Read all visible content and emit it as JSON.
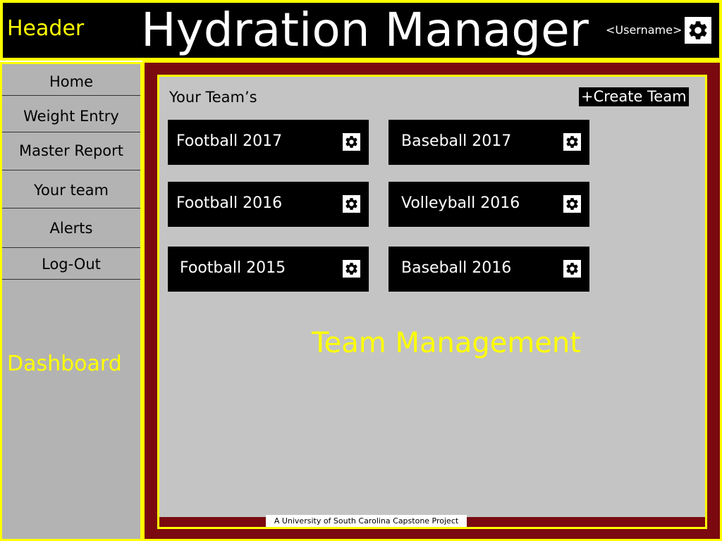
{
  "header": {
    "tag": "Header",
    "title": "Hydration Manager",
    "username": "<Username>",
    "settings_icon": "gear-icon"
  },
  "sidebar": {
    "tag": "Dashboard",
    "items": [
      {
        "label": "Home"
      },
      {
        "label": "Weight Entry"
      },
      {
        "label": "Master Report"
      },
      {
        "label": "Your team"
      },
      {
        "label": "Alerts"
      },
      {
        "label": "Log-Out"
      }
    ]
  },
  "main": {
    "section_title": "Your Team’s",
    "create_team_label": "+Create Team",
    "teams": [
      {
        "name": "Football 2017",
        "icon": "gear-icon"
      },
      {
        "name": "Baseball 2017",
        "icon": "gear-icon"
      },
      {
        "name": "Football 2016",
        "icon": "gear-icon"
      },
      {
        "name": "Volleyball 2016",
        "icon": "gear-icon"
      },
      {
        "name": "Football 2015",
        "icon": "gear-icon"
      },
      {
        "name": "Baseball 2016",
        "icon": "gear-icon"
      }
    ],
    "tag": "Team Management",
    "footer_note": "A University of South Carolina Capstone Project"
  },
  "colors": {
    "accent": "#ffff00",
    "header_bg": "#000000",
    "sidebar_bg": "#b3b3b3",
    "frame_bg": "#7a0a10",
    "panel_bg": "#c4c4c4",
    "card_bg": "#000000"
  }
}
